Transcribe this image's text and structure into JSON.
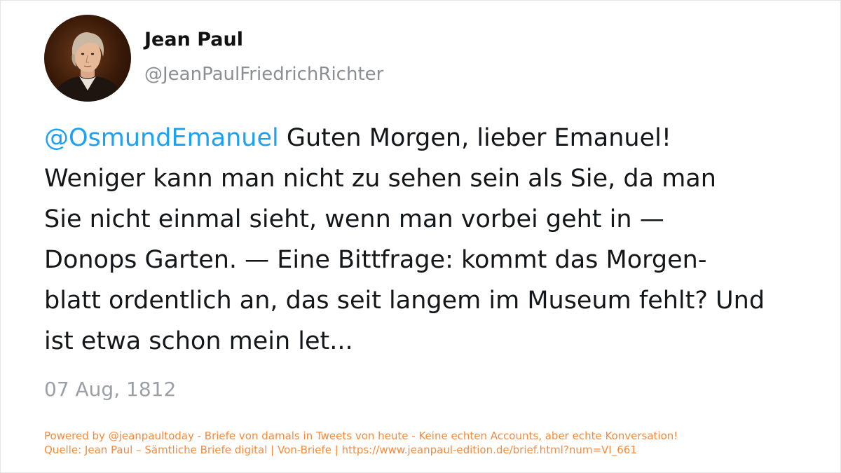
{
  "author": {
    "name": "Jean Paul",
    "handle": "@JeanPaulFriedrichRichter",
    "avatar_icon": "portrait-avatar"
  },
  "tweet": {
    "mention": "@OsmundEmanuel",
    "lines": [
      " Guten Morgen, lieber Emanuel!",
      "Weniger kann man nicht zu sehen sein als Sie, da man",
      "Sie nicht einmal sieht, wenn man vorbei geht in —",
      "Donops Garten. — Eine Bittfrage: kommt das Morgen-",
      "blatt ordentlich an, das seit langem im Museum fehlt? Und",
      "ist etwa schon mein let..."
    ],
    "date": "07 Aug, 1812"
  },
  "footer": {
    "line1": "Powered by @jeanpaultoday - Briefe von damals in Tweets von heute - Keine echten Accounts, aber echte Konversation!",
    "line2": "Quelle: Jean Paul – Sämtliche Briefe digital | Von-Briefe | https://www.jeanpaul-edition.de/brief.html?num=VI_661"
  },
  "colors": {
    "mention": "#1da1f2",
    "text": "#14171a",
    "muted": "#8a8f94",
    "footer": "#f58a3c"
  }
}
